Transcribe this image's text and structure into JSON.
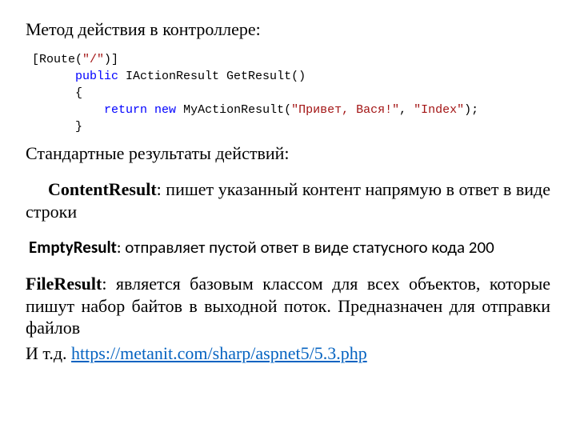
{
  "heading": "Метод действия в контроллере:",
  "code": {
    "l1a": "[Route(",
    "l1b": "\"/\"",
    "l1c": ")]",
    "l2a": "      ",
    "l2b": "public",
    "l2c": " IActionResult GetResult()",
    "l3": "      {",
    "l4a": "          ",
    "l4b": "return",
    "l4c": " ",
    "l4d": "new",
    "l4e": " MyActionResult(",
    "l4f": "\"Привет, Вася!\"",
    "l4g": ", ",
    "l4h": "\"Index\"",
    "l4i": ");",
    "l5": "      }"
  },
  "std_heading": "Стандартные результаты действий:",
  "content_result": {
    "term": "ContentResult",
    "text": ": пишет указанный контент напрямую в ответ в виде строки"
  },
  "empty_result": {
    "term": "EmptyResult",
    "text": ": отправляет пустой ответ в виде статусного кода 200"
  },
  "file_result": {
    "term": "FileResult",
    "text": ": является базовым классом для всех объектов, которые пишут набор байтов в выходной поток. Предназначен для отправки файлов"
  },
  "etc_prefix": "И т.д. ",
  "link_text": "https://metanit.com/sharp/aspnet5/5.3.php",
  "link_href": "https://metanit.com/sharp/aspnet5/5.3.php"
}
